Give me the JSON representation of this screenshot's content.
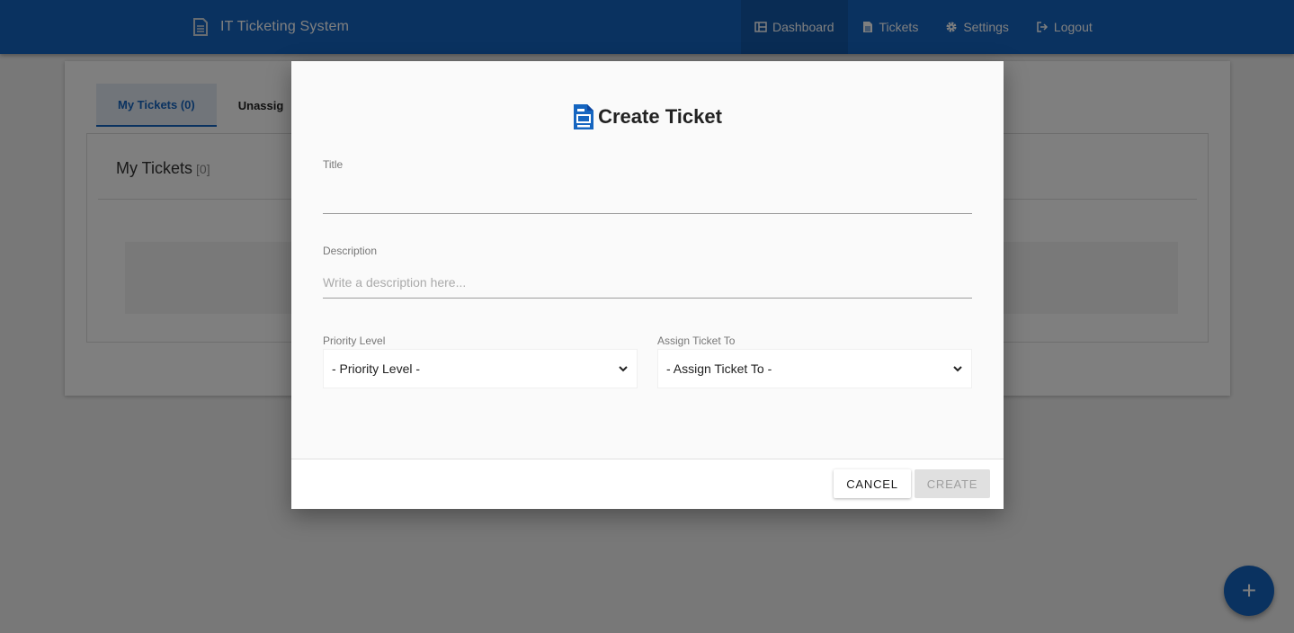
{
  "app": {
    "title": "IT Ticketing System",
    "accent_color": "#1565c0"
  },
  "nav": {
    "items": [
      {
        "label": "Dashboard",
        "icon": "dashboard-icon",
        "active": true
      },
      {
        "label": "Tickets",
        "icon": "file-icon",
        "active": false
      },
      {
        "label": "Settings",
        "icon": "gear-icon",
        "active": false
      },
      {
        "label": "Logout",
        "icon": "logout-icon",
        "active": false
      }
    ]
  },
  "background_page": {
    "tabs": [
      {
        "label": "My Tickets (0)",
        "active": true
      },
      {
        "label": "Unassig",
        "active": false
      }
    ],
    "panel_title": "My Tickets",
    "panel_count": "[0]"
  },
  "fab": {
    "label": "+",
    "icon": "plus-icon"
  },
  "modal": {
    "title": "Create Ticket",
    "icon": "document-icon",
    "fields": {
      "title_label": "Title",
      "title_value": "",
      "description_label": "Description",
      "description_placeholder": "Write a description here...",
      "priority_label": "Priority Level",
      "priority_selected": "- Priority Level -",
      "assign_label": "Assign Ticket To",
      "assign_selected": "- Assign Ticket To -"
    },
    "buttons": {
      "cancel": "CANCEL",
      "create": "CREATE"
    }
  }
}
